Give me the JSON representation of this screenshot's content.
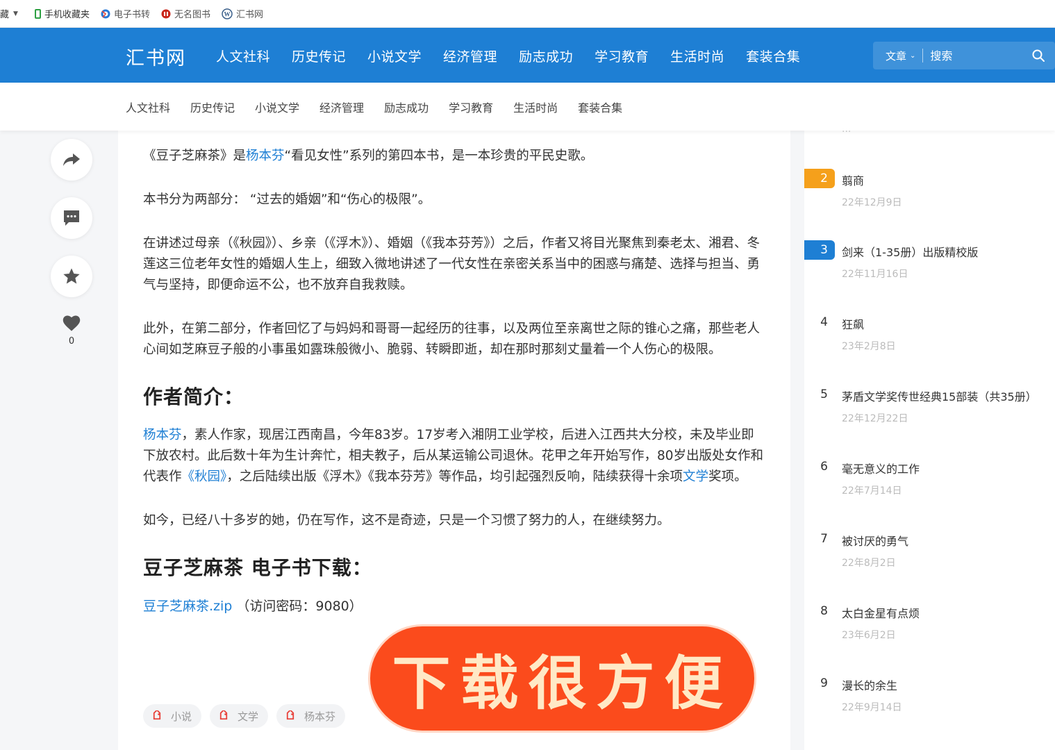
{
  "bookmarks": [
    {
      "label": "藏",
      "icon": "bookmark-fragment"
    },
    {
      "label": "手机收藏夹",
      "icon": "phone-icon"
    },
    {
      "label": "电子书转",
      "icon": "browser-icon"
    },
    {
      "label": "无名图书",
      "icon": "book-icon"
    },
    {
      "label": "汇书网",
      "icon": "wordpress-icon"
    }
  ],
  "header": {
    "logo": "汇书网",
    "nav": [
      "人文社科",
      "历史传记",
      "小说文学",
      "经济管理",
      "励志成功",
      "学习教育",
      "生活时尚",
      "套装合集"
    ],
    "search_category": "文章",
    "search_placeholder": "搜索"
  },
  "subnav": [
    "人文社科",
    "历史传记",
    "小说文学",
    "经济管理",
    "励志成功",
    "学习教育",
    "生活时尚",
    "套装合集"
  ],
  "actions": {
    "like_count": "0"
  },
  "article": {
    "p1_pre": "《豆子芝麻茶》是",
    "p1_link": "杨本芬",
    "p1_post": "“看见女性”系列的第四本书，是一本珍贵的平民史歌。",
    "p2": "本书分为两部分： “过去的婚姻”和“伤心的极限”。",
    "p3": "在讲述过母亲（《秋园》）、乡亲（《浮木》）、婚姻（《我本芬芳》）之后，作者又将目光聚焦到秦老太、湘君、冬莲这三位老年女性的婚姻人生上，细致入微地讲述了一代女性在亲密关系当中的困惑与痛楚、选择与担当、勇气与坚持，即便命运不公，也不放弃自我救赎。",
    "p4": "此外，在第二部分，作者回忆了与妈妈和哥哥一起经历的往事，以及两位至亲离世之际的锥心之痛，那些老人心间如芝麻豆子般的小事虽如露珠般微小、脆弱、转瞬即逝，却在那时那刻丈量着一个人伤心的极限。",
    "h_author": "作者简介：",
    "a_link": "杨本芬",
    "a_text1": "，素人作家，现居江西南昌，今年83岁。17岁考入湘阴工业学校，后进入江西共大分校，未及毕业即下放农村。此后数十年为生计奔忙，相夫教子，后从某运输公司退休。花甲之年开始写作，80岁出版处女作和代表作",
    "a_link2": "《秋园》",
    "a_text2": "，之后陆续出版《浮木》《我本芬芳》等作品，均引起强烈反响，陆续获得十余项",
    "a_link3": "文学",
    "a_text3": "奖项。",
    "p5": "如今，已经八十多岁的她，仍在写作，这不是奇迹，只是一个习惯了努力的人，在继续努力。",
    "h_download": "豆子芝麻茶 电子书下载：",
    "dl_link": "豆子芝麻茶.zip",
    "dl_note": "（访问密码：9080）",
    "tags": [
      "小说",
      "文学",
      "杨本芬"
    ]
  },
  "sticker": "下载很方便",
  "sidebar": {
    "ranks": [
      {
        "num": "2",
        "title": "翦商",
        "date": "22年12月9日",
        "badge": "#f5a01b"
      },
      {
        "num": "3",
        "title": "剑来（1-35册）出版精校版",
        "date": "22年11月16日",
        "badge": "#1e7fd4"
      },
      {
        "num": "4",
        "title": "狂飙",
        "date": "23年2月8日",
        "badge": ""
      },
      {
        "num": "5",
        "title": "茅盾文学奖传世经典15部装（共35册）",
        "date": "22年12月22日",
        "badge": ""
      },
      {
        "num": "6",
        "title": "毫无意义的工作",
        "date": "22年7月14日",
        "badge": ""
      },
      {
        "num": "7",
        "title": "被讨厌的勇气",
        "date": "22年8月2日",
        "badge": ""
      },
      {
        "num": "8",
        "title": "太白金星有点烦",
        "date": "23年6月2日",
        "badge": ""
      },
      {
        "num": "9",
        "title": "漫长的余生",
        "date": "22年9月14日",
        "badge": ""
      }
    ]
  }
}
